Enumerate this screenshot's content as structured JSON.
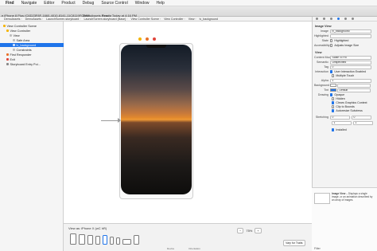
{
  "menubar": {
    "app": "Find",
    "items": [
      "Navigate",
      "Editor",
      "Product",
      "Debug",
      "Source Control",
      "Window",
      "Help"
    ]
  },
  "toolbar": {
    "device": "e iPhone 8 Plus (C6D23F8F-1660-4010-8141-11C8119FCB53)",
    "scheme": "DemoAssets",
    "status_label": "Ready",
    "status_time": "Today at 4:16 PM"
  },
  "jumpbar": {
    "crumbs": [
      "DemoAssets",
      "DemoAssets",
      "LaunchScreen.storyboard",
      "LaunchScreen.storyboard (Base)",
      "View Controller Scene",
      "View Controller",
      "View",
      "iv_background"
    ]
  },
  "outline": {
    "rows": [
      {
        "label": "View Controller Scene",
        "indent": 0,
        "color": "#f4b400",
        "selected": false
      },
      {
        "label": "View Controller",
        "indent": 1,
        "color": "#f4b400",
        "selected": false
      },
      {
        "label": "View",
        "indent": 2,
        "color": "#bdbdbd",
        "selected": false
      },
      {
        "label": "Safe Area",
        "indent": 3,
        "color": "#bdbdbd",
        "selected": false
      },
      {
        "label": "iv_background",
        "indent": 3,
        "color": "#4a90e2",
        "selected": true
      },
      {
        "label": "Constraints",
        "indent": 3,
        "color": "#bdbdbd",
        "selected": false
      },
      {
        "label": "First Responder",
        "indent": 1,
        "color": "#e8712a",
        "selected": false
      },
      {
        "label": "Exit",
        "indent": 1,
        "color": "#e0443a",
        "selected": false
      },
      {
        "label": "Storyboard Entry Poi...",
        "indent": 1,
        "color": "#888888",
        "selected": false
      }
    ]
  },
  "canvas": {
    "zoom": "75%",
    "view_as": "View as: iPhone X (wC hR)",
    "vary_button": "Vary for Traits",
    "device_labels": [
      "Device",
      "Orientation"
    ]
  },
  "inspector": {
    "image_view_header": "Image View",
    "image_label": "Image",
    "image_value": "iv_background",
    "highlighted_label": "Highlighted",
    "state_label": "State",
    "highlighted_checkbox": "Highlighted",
    "accessibility_label": "Accessibility",
    "adjust_checkbox": "Adjusts Image Size",
    "view_header": "View",
    "content_mode_label": "Content Mode",
    "content_mode_value": "Scale To Fill",
    "semantic_label": "Semantic",
    "semantic_value": "Unspecified",
    "tag_label": "Tag",
    "tag_value": "0",
    "interaction_label": "Interaction",
    "user_interaction": "User Interaction Enabled",
    "multiple_touch": "Multiple Touch",
    "alpha_label": "Alpha",
    "alpha_value": "1",
    "background_label": "Background",
    "tint_label": "Tint",
    "tint_value": "Default",
    "drawing_label": "Drawing",
    "opaque": "Opaque",
    "hidden": "Hidden",
    "clears_graphics": "Clears Graphics Context",
    "clip_to_bounds": "Clip to Bounds",
    "autoresize": "Autoresize Subviews",
    "stretching_label": "Stretching",
    "stretch_x": "0",
    "stretch_y": "0",
    "stretch_w": "1",
    "stretch_h": "1",
    "installed": "Installed",
    "library_title": "Image View",
    "library_desc": "Displays a single image, or an animation described by an array of images.",
    "library_filter": "Filter"
  }
}
